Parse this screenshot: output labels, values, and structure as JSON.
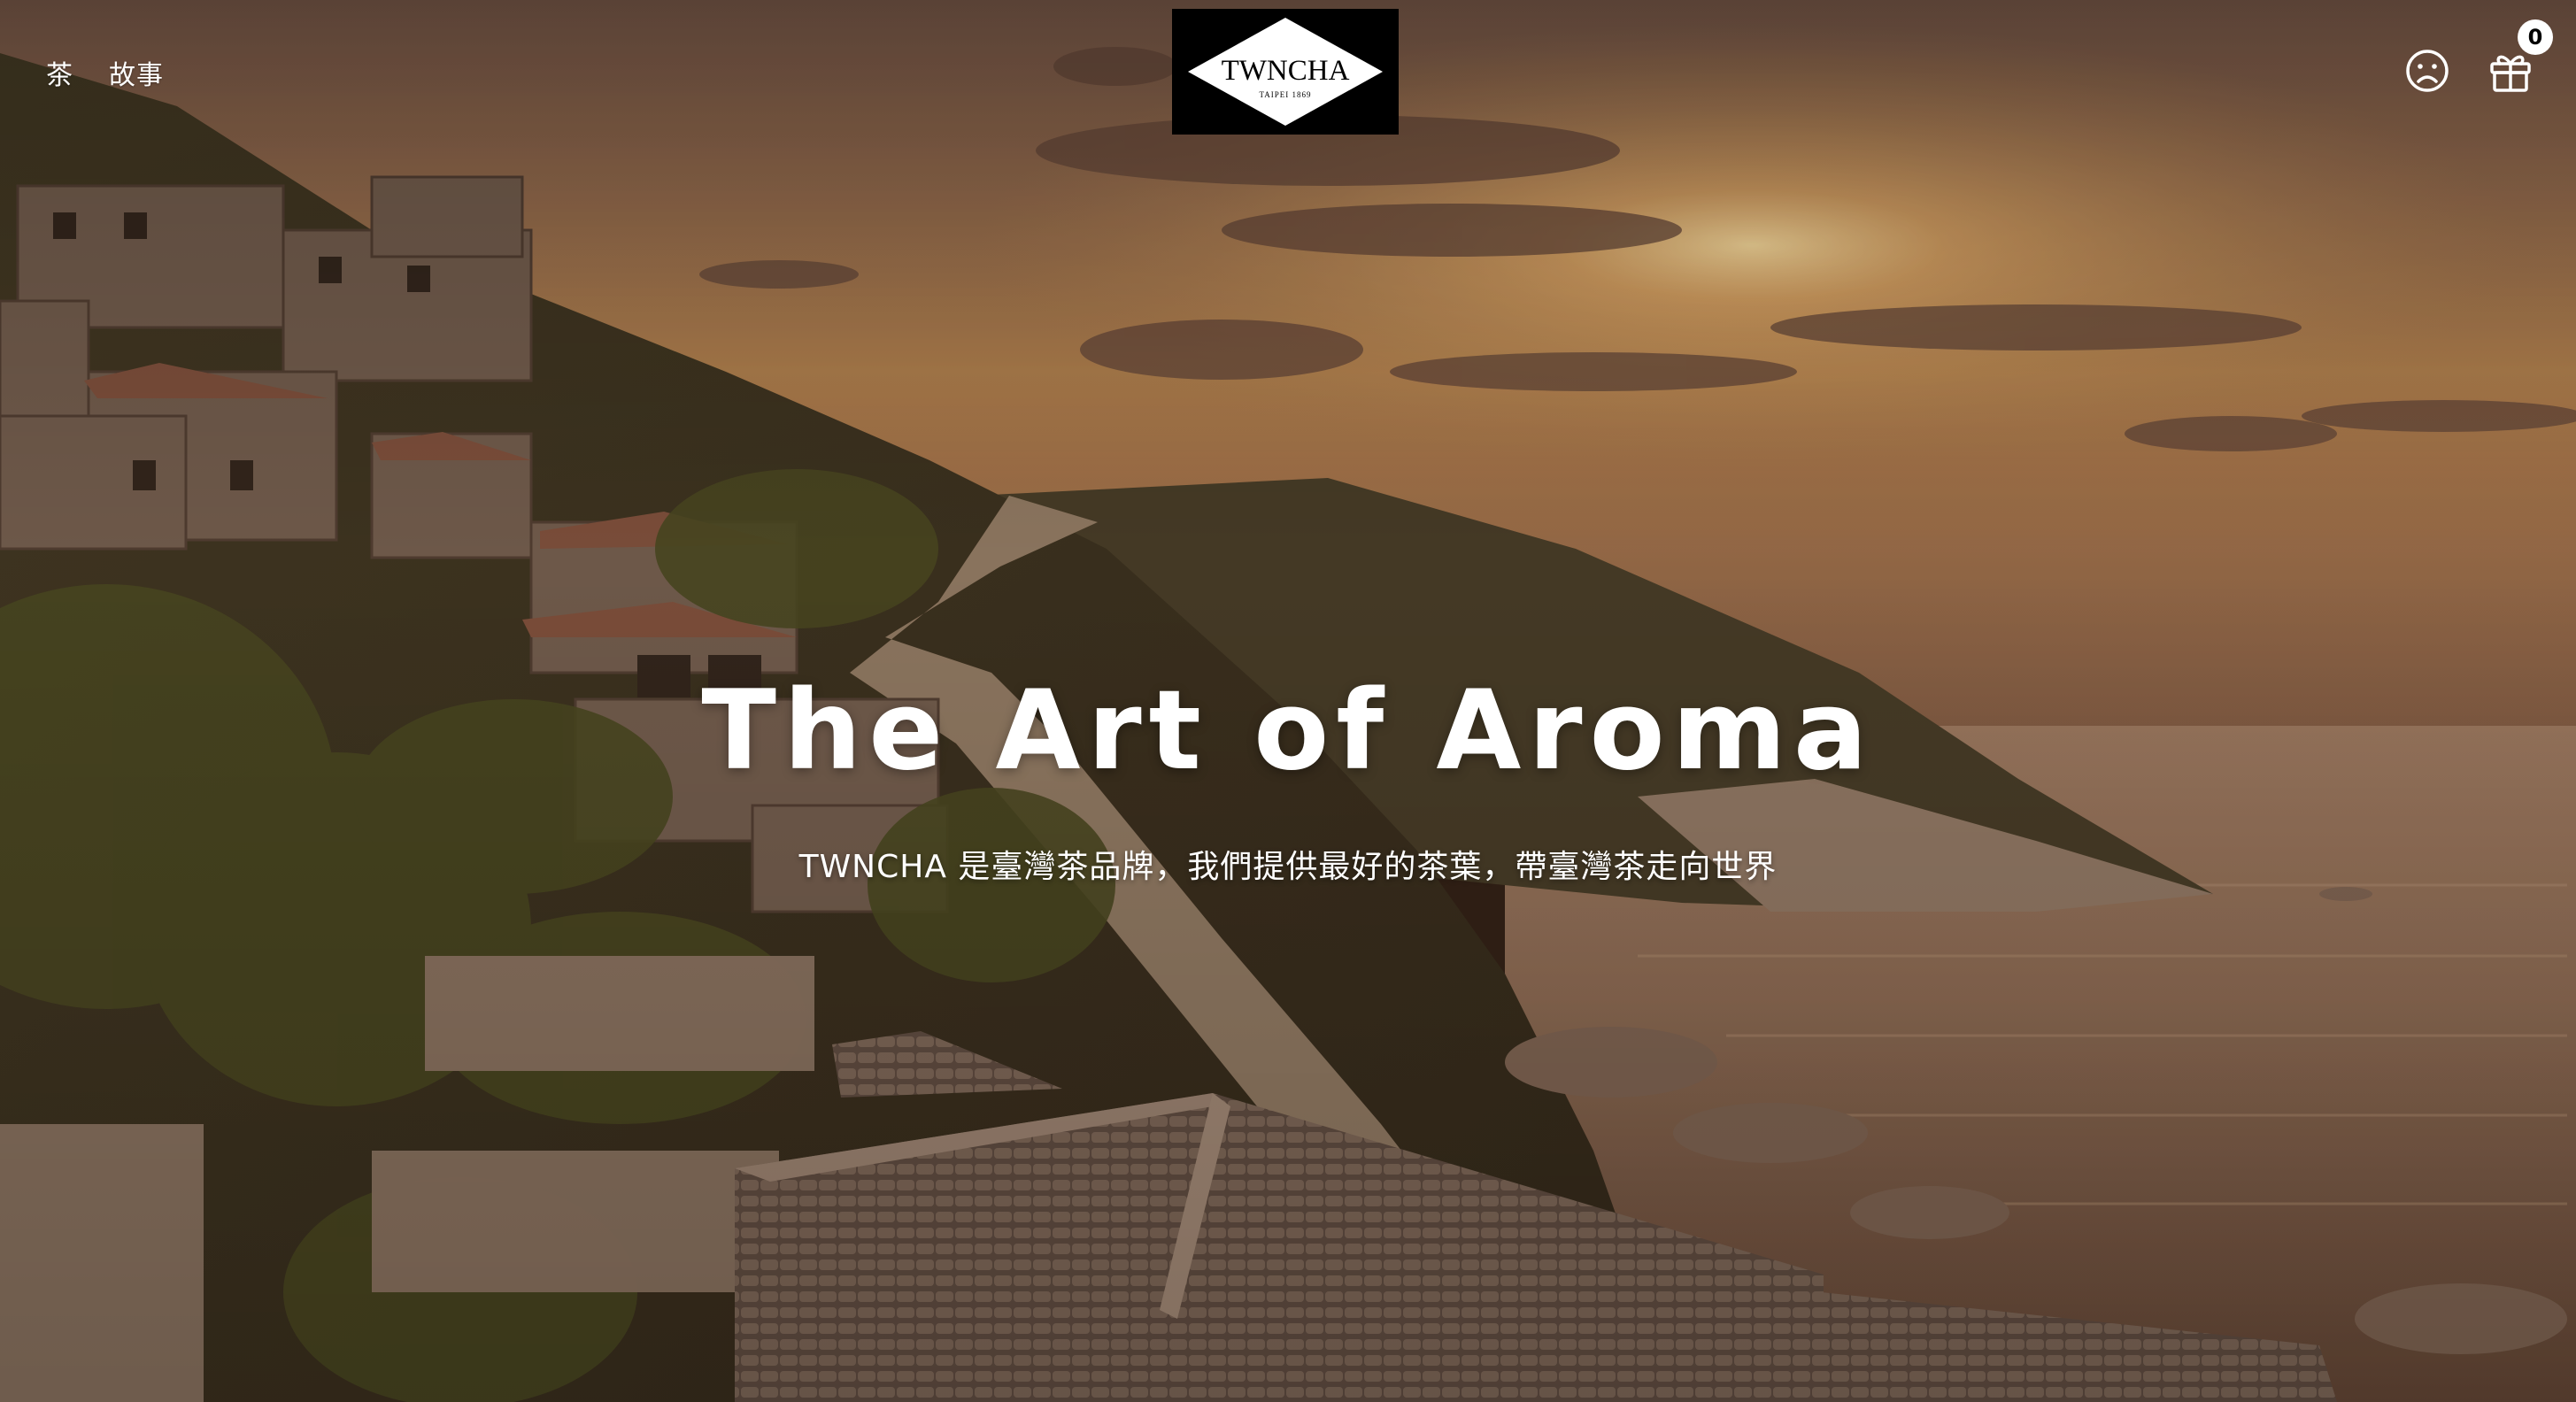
{
  "header": {
    "nav_left": [
      "茶",
      "故事"
    ],
    "logo": {
      "brand": "TWNCHA",
      "tagline": "TAIPEI 1869"
    },
    "cart_count": "0"
  },
  "hero": {
    "title": "The Art of Aroma",
    "subtitle": "TWNCHA 是臺灣茶品牌，我們提供最好的茶葉，帶臺灣茶走向世界"
  },
  "icons": {
    "account": "frown-face-icon",
    "cart": "gift-icon"
  },
  "colors": {
    "text": "#ffffff",
    "logo_bg": "#000000",
    "badge_bg": "#ffffff"
  }
}
